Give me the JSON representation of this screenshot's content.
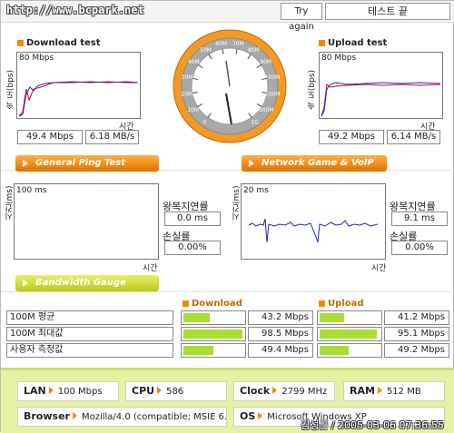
{
  "header": {
    "url": "http://www.bcpark.net",
    "try_again": "Try again",
    "status": "테스트 끝"
  },
  "download": {
    "title": "Download test",
    "ylabel": "속 도(bps)",
    "ymax": "80 Mbps",
    "xlabel": "시간",
    "mbps": "49.4 Mbps",
    "mbs": "6.18 MB/s"
  },
  "upload": {
    "title": "Upload test",
    "ylabel": "속 도(bps)",
    "ymax": "80 Mbps",
    "xlabel": "시간",
    "mbps": "49.2 Mbps",
    "mbs": "6.14 MB/s"
  },
  "gauge": {
    "ticks": [
      "0",
      "10M",
      "20M",
      "30M",
      "40M",
      "50M",
      "60M",
      "70M",
      "80M",
      "90M",
      "100M",
      "200M",
      "500M",
      "1G"
    ],
    "needle_value": "49.4"
  },
  "ping": {
    "tab": "General Ping Test",
    "ylabel": "시간(ms)",
    "ymax": "100 ms",
    "xlabel": "시간",
    "rtt_label": "왕복지연률",
    "rtt": "0.0 ms",
    "loss_label": "손실률",
    "loss": "0.00%"
  },
  "game": {
    "tab": "Network Game & VoIP Test",
    "ylabel": "시간(ms)",
    "ymax": "20 ms",
    "xlabel": "시간",
    "rtt_label": "왕복지연률",
    "rtt": "9.1 ms",
    "loss_label": "손실률",
    "loss": "0.00%"
  },
  "bandwidth": {
    "tab": "Bandwidth Gauge",
    "download_head": "Download",
    "upload_head": "Upload",
    "rows": [
      {
        "name": "100M 평균",
        "down": "43.2 Mbps",
        "down_pct": 43.2,
        "up": "41.2 Mbps",
        "up_pct": 41.2
      },
      {
        "name": "100M 최대값",
        "down": "98.5 Mbps",
        "down_pct": 98.5,
        "up": "95.1 Mbps",
        "up_pct": 95.1
      },
      {
        "name": "사용자 측정값",
        "down": "49.4 Mbps",
        "down_pct": 49.4,
        "up": "49.2 Mbps",
        "up_pct": 49.2
      }
    ]
  },
  "footer": {
    "lan_label": "LAN",
    "lan": "100 Mbps",
    "cpu_label": "CPU",
    "cpu": "586",
    "clock_label": "Clock",
    "clock": "2799 MHz",
    "ram_label": "RAM",
    "ram": "512 MB",
    "browser_label": "Browser",
    "browser": "Mozilla/4.0 (compatible; MSIE 6.0",
    "os_label": "OS",
    "os": "Microsoft Windows XP",
    "stamp": "김성근 / 2005-03-06 07:36:55"
  },
  "colors": {
    "accent": "#f08a00",
    "bar": "#a7dd33",
    "footer": "#e5f2a6"
  }
}
